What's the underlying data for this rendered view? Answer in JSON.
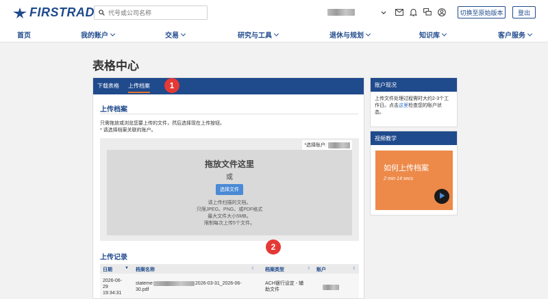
{
  "header": {
    "logo_text": "FIRSTRADE",
    "search_placeholder": "代号或公司名称",
    "switch_version_label": "切换至原始版本",
    "logout_label": "登出"
  },
  "nav": {
    "items": [
      {
        "label": "首页"
      },
      {
        "label": "我的账户"
      },
      {
        "label": "交易"
      },
      {
        "label": "研究与工具"
      },
      {
        "label": "退休与规划"
      },
      {
        "label": "知识库"
      },
      {
        "label": "客户服务"
      }
    ]
  },
  "page": {
    "title": "表格中心"
  },
  "tabs": {
    "download": "下载表格",
    "upload": "上传档案"
  },
  "upload": {
    "title": "上传档案",
    "instruction_1": "只需拖放或浏览您要上传的文件，然后选择现在上传按钮。",
    "instruction_2": "* 请选择档案关联的账户。",
    "select_account_label": "*选择账户:",
    "drop_title": "拖放文件这里",
    "drop_or": "或",
    "choose_file_label": "选择文件",
    "notes": [
      "请上传扫描的文档。",
      "只限JPEG、PNG、或PDF格式",
      "最大文件大小5MB。",
      "限制每次上传5个文件。"
    ]
  },
  "records": {
    "title": "上传记录",
    "columns": {
      "date": "日期",
      "name": "档案名称",
      "type": "档案类型",
      "account": "账户"
    },
    "rows": [
      {
        "date_1": "2026-06-",
        "date_2": "29",
        "date_3": "19:34:31",
        "name_prefix": "stateme",
        "name_suffix": "2026-03-31_2026-06-",
        "name_line2": "30.pdf",
        "type_1": "ACH银行设定 - 辅",
        "type_2": "助文件"
      }
    ]
  },
  "sidebar": {
    "status_title": "账户现况",
    "status_text_1": "上传文件处理过程需时大约2-3个工",
    "status_text_2": "作日。点击",
    "status_link": "这里",
    "status_text_3": "检查您的账户状",
    "status_text_4": "态。",
    "video_title": "视频教学",
    "video_caption": "如何上传档案",
    "video_duration": "2 min 14 secs"
  },
  "annotations": {
    "badge_1": "1",
    "badge_2": "2"
  },
  "colors": {
    "brand": "#1f4a8c",
    "accent": "#e8742a",
    "badge": "#e53935"
  }
}
